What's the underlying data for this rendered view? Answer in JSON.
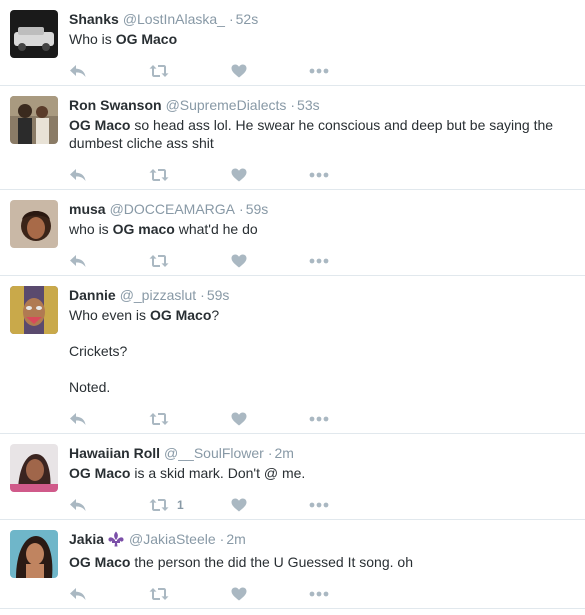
{
  "tweets": [
    {
      "name": "Shanks",
      "handle": "@LostInAlaska_",
      "separator": "·",
      "time": "52s",
      "paragraphs": [
        [
          {
            "t": "Who is "
          },
          {
            "t": "OG Maco",
            "b": true
          }
        ]
      ],
      "retweet_count": ""
    },
    {
      "name": "Ron Swanson",
      "handle": "@SupremeDialects",
      "separator": "·",
      "time": "53s",
      "paragraphs": [
        [
          {
            "t": "OG Maco",
            "b": true
          },
          {
            "t": " so head ass lol. He swear he conscious and deep but be saying the dumbest cliche ass shit"
          }
        ]
      ],
      "retweet_count": ""
    },
    {
      "name": "musa",
      "handle": "@DOCCEAMARGA",
      "separator": "·",
      "time": "59s",
      "paragraphs": [
        [
          {
            "t": "who is "
          },
          {
            "t": "OG maco",
            "b": true
          },
          {
            "t": " what'd he do"
          }
        ]
      ],
      "retweet_count": ""
    },
    {
      "name": "Dannie",
      "handle": "@_pizzaslut",
      "separator": "·",
      "time": "59s",
      "paragraphs": [
        [
          {
            "t": "Who even is "
          },
          {
            "t": "OG Maco",
            "b": true
          },
          {
            "t": "?"
          }
        ],
        [
          {
            "t": "Crickets?"
          }
        ],
        [
          {
            "t": "Noted."
          }
        ]
      ],
      "retweet_count": ""
    },
    {
      "name": "Hawaiian Roll",
      "handle": "@__SoulFlower",
      "separator": "·",
      "time": "2m",
      "paragraphs": [
        [
          {
            "t": "OG Maco",
            "b": true
          },
          {
            "t": " is a skid mark. Don't @ me."
          }
        ]
      ],
      "retweet_count": "1"
    },
    {
      "name": "Jakia",
      "handle": "@JakiaSteele",
      "separator": "·",
      "time": "2m",
      "name_emoji": "fleur-de-lis-icon",
      "paragraphs": [
        [
          {
            "t": "OG Maco",
            "b": true
          },
          {
            "t": " the person the did the U Guessed It song. oh"
          }
        ]
      ],
      "retweet_count": ""
    }
  ],
  "icons": {
    "reply": "reply-icon",
    "retweet": "retweet-icon",
    "like": "heart-icon",
    "more": "more-dots-icon"
  },
  "colors": {
    "text": "#292f33",
    "meta": "#8899a6",
    "action_icon": "#aab8c2",
    "divider": "#e1e8ed",
    "emoji": "#7b4fa8"
  }
}
